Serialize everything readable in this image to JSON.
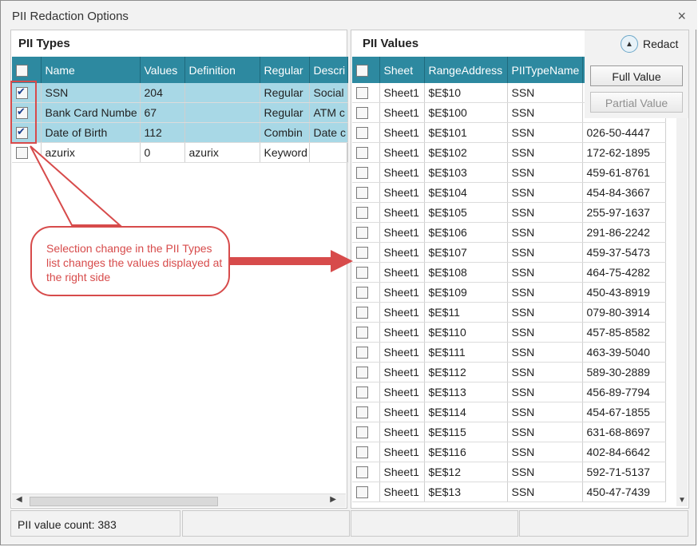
{
  "window": {
    "title": "PII Redaction Options",
    "close_glyph": "×"
  },
  "left": {
    "title": "PII Types",
    "columns": [
      "Name",
      "Values",
      "Definition",
      "Regular",
      "Descri"
    ],
    "rows": [
      {
        "checked": true,
        "selected": true,
        "name": "SSN",
        "values": "204",
        "definition": "",
        "regular": "Regular",
        "descr": "Social"
      },
      {
        "checked": true,
        "selected": true,
        "name": "Bank Card Numbe",
        "values": "67",
        "definition": "",
        "regular": "Regular",
        "descr": "ATM c"
      },
      {
        "checked": true,
        "selected": true,
        "name": "Date of Birth",
        "values": "112",
        "definition": "",
        "regular": "Combin",
        "descr": "Date c"
      },
      {
        "checked": false,
        "selected": false,
        "name": "azurix",
        "values": "0",
        "definition": "azurix",
        "regular": "Keyword",
        "descr": ""
      }
    ]
  },
  "right": {
    "title": "PII Values",
    "columns": [
      "Sheet",
      "RangeAddress",
      "PIITypeName",
      ""
    ],
    "rows": [
      {
        "sheet": "Sheet1",
        "range": "$E$10",
        "type": "SSN",
        "value": ""
      },
      {
        "sheet": "Sheet1",
        "range": "$E$100",
        "type": "SSN",
        "value": ""
      },
      {
        "sheet": "Sheet1",
        "range": "$E$101",
        "type": "SSN",
        "value": "026-50-4447"
      },
      {
        "sheet": "Sheet1",
        "range": "$E$102",
        "type": "SSN",
        "value": "172-62-1895"
      },
      {
        "sheet": "Sheet1",
        "range": "$E$103",
        "type": "SSN",
        "value": "459-61-8761"
      },
      {
        "sheet": "Sheet1",
        "range": "$E$104",
        "type": "SSN",
        "value": "454-84-3667"
      },
      {
        "sheet": "Sheet1",
        "range": "$E$105",
        "type": "SSN",
        "value": "255-97-1637"
      },
      {
        "sheet": "Sheet1",
        "range": "$E$106",
        "type": "SSN",
        "value": "291-86-2242"
      },
      {
        "sheet": "Sheet1",
        "range": "$E$107",
        "type": "SSN",
        "value": "459-37-5473"
      },
      {
        "sheet": "Sheet1",
        "range": "$E$108",
        "type": "SSN",
        "value": "464-75-4282"
      },
      {
        "sheet": "Sheet1",
        "range": "$E$109",
        "type": "SSN",
        "value": "450-43-8919"
      },
      {
        "sheet": "Sheet1",
        "range": "$E$11",
        "type": "SSN",
        "value": "079-80-3914"
      },
      {
        "sheet": "Sheet1",
        "range": "$E$110",
        "type": "SSN",
        "value": "457-85-8582"
      },
      {
        "sheet": "Sheet1",
        "range": "$E$111",
        "type": "SSN",
        "value": "463-39-5040"
      },
      {
        "sheet": "Sheet1",
        "range": "$E$112",
        "type": "SSN",
        "value": "589-30-2889"
      },
      {
        "sheet": "Sheet1",
        "range": "$E$113",
        "type": "SSN",
        "value": "456-89-7794"
      },
      {
        "sheet": "Sheet1",
        "range": "$E$114",
        "type": "SSN",
        "value": "454-67-1855"
      },
      {
        "sheet": "Sheet1",
        "range": "$E$115",
        "type": "SSN",
        "value": "631-68-8697"
      },
      {
        "sheet": "Sheet1",
        "range": "$E$116",
        "type": "SSN",
        "value": "402-84-6642"
      },
      {
        "sheet": "Sheet1",
        "range": "$E$12",
        "type": "SSN",
        "value": "592-71-5137"
      },
      {
        "sheet": "Sheet1",
        "range": "$E$13",
        "type": "SSN",
        "value": "450-47-7439"
      }
    ]
  },
  "actions": {
    "redact_label": "Redact",
    "full_value_label": "Full Value",
    "partial_value_label": "Partial Value"
  },
  "status": {
    "count_text": "PII value count: 383"
  },
  "callout": {
    "text": "Selection change in the PII Types list changes the values displayed at the right side"
  },
  "colors": {
    "header_bg": "#2d89a0",
    "selected_row": "#a8d8e6",
    "annotation_red": "#d74b4b"
  },
  "icons": {
    "redact": "chevron-up-circle-icon",
    "close": "close-icon"
  }
}
